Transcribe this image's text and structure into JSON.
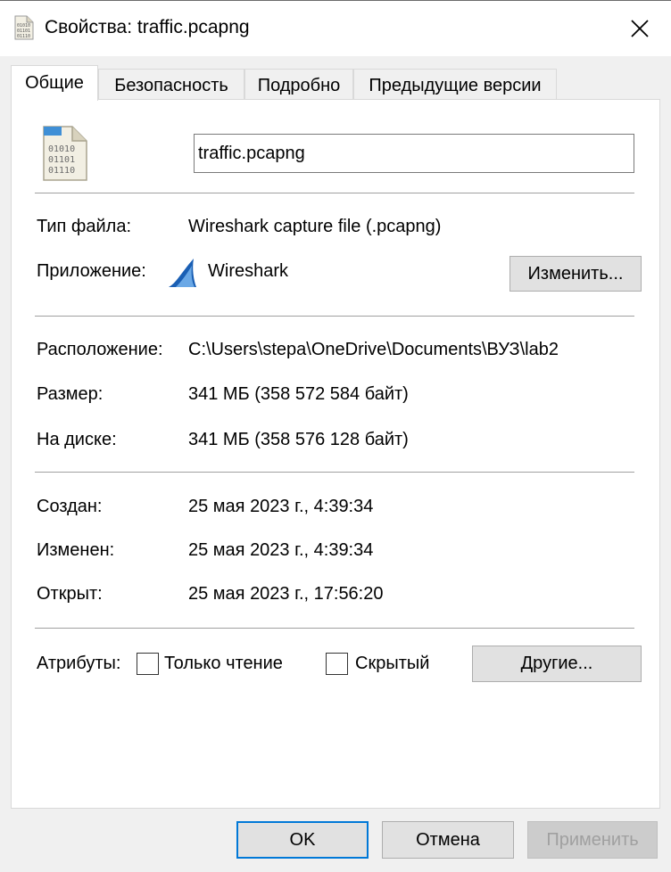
{
  "window": {
    "title": "Свойства: traffic.pcapng",
    "close_label": "✕"
  },
  "tabs": [
    {
      "label": "Общие",
      "active": true
    },
    {
      "label": "Безопасность",
      "active": false
    },
    {
      "label": "Подробно",
      "active": false
    },
    {
      "label": "Предыдущие версии",
      "active": false
    }
  ],
  "general": {
    "file_name": "traffic.pcapng",
    "file_icon_lines": [
      "01010",
      "01101",
      "01110"
    ],
    "type_label": "Тип файла:",
    "type_value": "Wireshark capture file (.pcapng)",
    "app_label": "Приложение:",
    "app_value": "Wireshark",
    "change_button": "Изменить...",
    "location_label": "Расположение:",
    "location_value": "C:\\Users\\stepa\\OneDrive\\Documents\\ВУЗ\\lab2",
    "size_label": "Размер:",
    "size_value": "341 МБ (358 572 584 байт)",
    "disk_label": "На диске:",
    "disk_value": "341 МБ (358 576 128 байт)",
    "created_label": "Создан:",
    "created_value": "25 мая 2023 г., 4:39:34",
    "modified_label": "Изменен:",
    "modified_value": "25 мая 2023 г., 4:39:34",
    "opened_label": "Открыт:",
    "opened_value": "25 мая 2023 г., 17:56:20",
    "attributes_label": "Атрибуты:",
    "readonly_label": "Только чтение",
    "readonly_checked": false,
    "hidden_label": "Скрытый",
    "hidden_checked": false,
    "other_button": "Другие..."
  },
  "footer": {
    "ok": "OK",
    "cancel": "Отмена",
    "apply": "Применить"
  },
  "colors": {
    "default_button_border": "#0078d7",
    "wireshark_blue": "#1a5fb4"
  }
}
